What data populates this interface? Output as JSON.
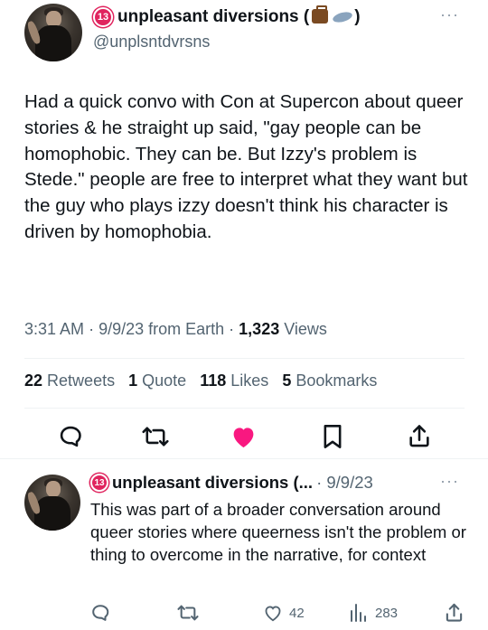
{
  "main_tweet": {
    "avatar_icon": "user-avatar",
    "badge": "13",
    "display_name": "unpleasant diversions (",
    "display_name_suffix": ")",
    "handle": "@unplsntdvrsns",
    "text": "Had a quick convo with Con at Supercon about queer stories & he straight up said, \"gay people can be homophobic. They can be. But Izzy's problem is Stede.\" people are free to interpret what they want but the guy who plays izzy doesn't think his character is driven by homophobia.",
    "time": "3:31 AM",
    "date": "9/9/23",
    "source": "from Earth",
    "views": "1,323",
    "views_label": "Views",
    "retweets": "22",
    "retweets_label": "Retweets",
    "quotes": "1",
    "quotes_label": "Quote",
    "likes": "118",
    "likes_label": "Likes",
    "bookmarks": "5",
    "bookmarks_label": "Bookmarks",
    "more_label": "···"
  },
  "reply_tweet": {
    "badge": "13",
    "display_name": "unpleasant diversions (...",
    "date": "· 9/9/23",
    "text": "This was part of a broader conversation around queer stories where queerness isn't the problem or thing to overcome in the narrative, for context",
    "likes": "42",
    "views": "283",
    "more_label": "···"
  },
  "colors": {
    "text": "#0f1419",
    "secondary": "#536471",
    "like_active": "#f91880",
    "badge": "#e0245e",
    "divider": "#eff3f4"
  }
}
